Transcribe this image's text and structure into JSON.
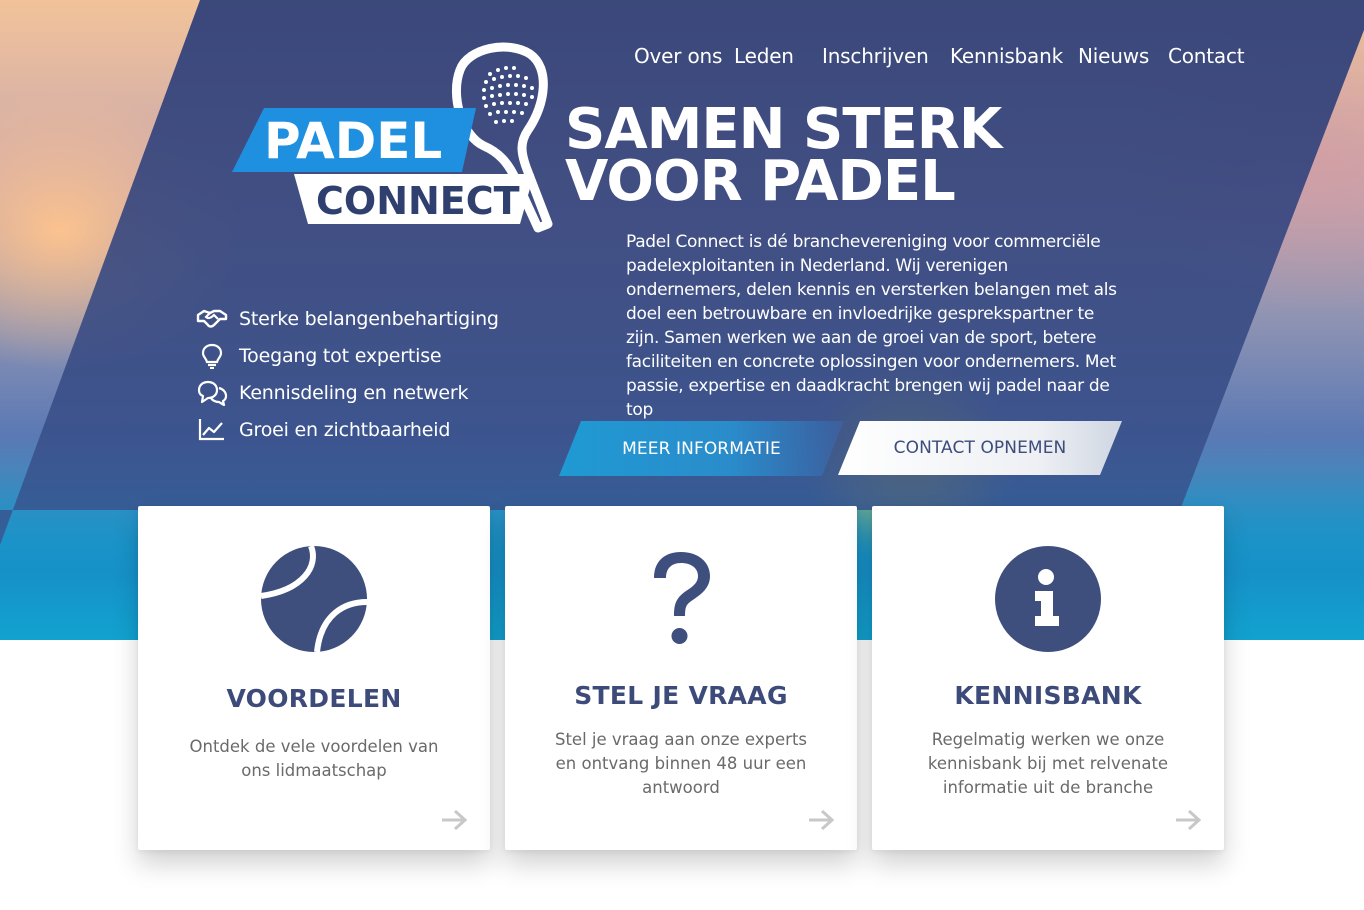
{
  "nav": {
    "items": [
      {
        "label": "Over ons"
      },
      {
        "label": "Leden"
      },
      {
        "label": "Inschrijven"
      },
      {
        "label": "Kennisbank"
      },
      {
        "label": "Nieuws"
      },
      {
        "label": "Contact"
      }
    ]
  },
  "logo": {
    "line1": "PADEL",
    "line2": "CONNECT"
  },
  "hero": {
    "headline_line1": "SAMEN STERK",
    "headline_line2": "VOOR PADEL",
    "intro": "Padel Connect is dé branchevereniging voor commerciële padelexploitanten in Nederland. Wij verenigen ondernemers, delen kennis en versterken belangen met als doel een betrouwbare en invloedrijke gesprekspartner te zijn. Samen werken we aan de groei van de sport, betere faciliteiten en concrete oplossingen voor ondernemers. Met passie, expertise en daadkracht brengen wij padel naar de top",
    "primary_button": "MEER INFORMATIE",
    "secondary_button": "CONTACT OPNEMEN"
  },
  "features": [
    {
      "icon": "handshake-icon",
      "label": "Sterke belangenbehartiging"
    },
    {
      "icon": "lightbulb-icon",
      "label": "Toegang tot expertise"
    },
    {
      "icon": "chat-bubbles-icon",
      "label": "Kennisdeling en netwerk"
    },
    {
      "icon": "growth-chart-icon",
      "label": "Groei en zichtbaarheid"
    }
  ],
  "cards": [
    {
      "icon": "tennis-ball-icon",
      "title": "VOORDELEN",
      "text": "Ontdek de vele voordelen van ons lidmaatschap"
    },
    {
      "icon": "question-mark-icon",
      "title": "STEL JE VRAAG",
      "text": "Stel je vraag aan onze experts en ontvang binnen 48 uur een antwoord"
    },
    {
      "icon": "info-icon",
      "title": "KENNISBANK",
      "text": "Regelmatig werken we onze kennisbank bij met relvenate informatie uit de branche"
    }
  ],
  "colors": {
    "brand_navy": "#3d4b7a",
    "brand_blue": "#1f8fe0",
    "cta_blue": "#1f9ad3",
    "card_text": "#6a6a6a"
  }
}
